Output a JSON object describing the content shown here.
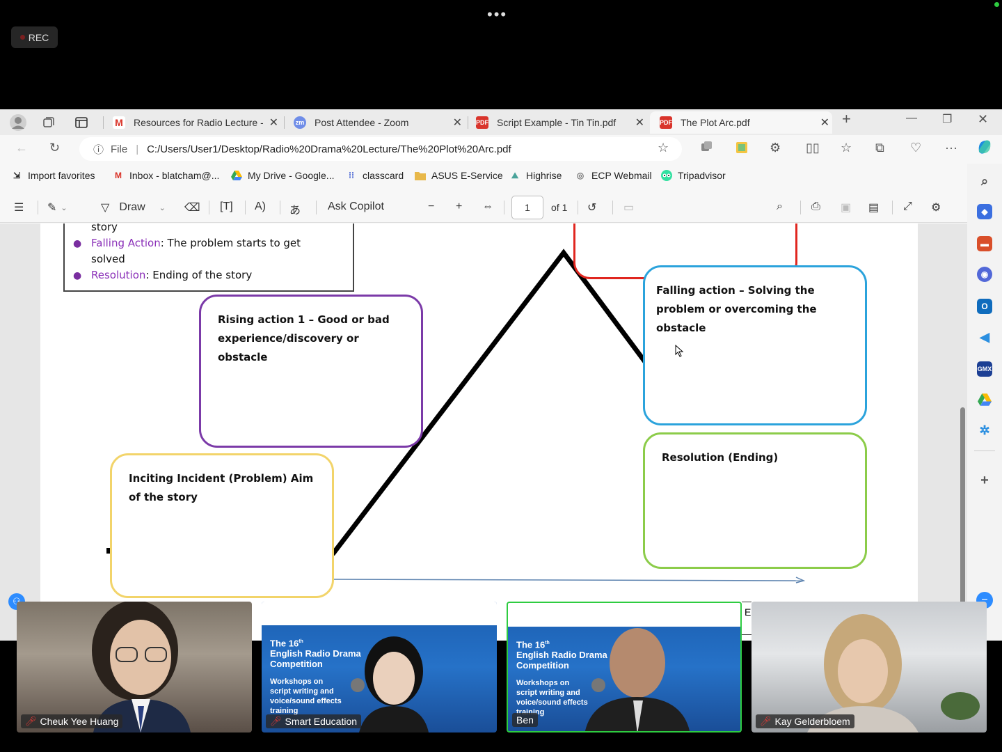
{
  "recording": {
    "label": "REC"
  },
  "browser": {
    "tabs": [
      {
        "label": "Resources for Radio Lecture - b",
        "icon": "gmail-icon"
      },
      {
        "label": "Post Attendee - Zoom",
        "icon": "zoom-icon"
      },
      {
        "label": "Script Example - Tin Tin.pdf",
        "icon": "pdf-icon"
      },
      {
        "label": "The Plot Arc.pdf",
        "icon": "pdf-icon"
      }
    ],
    "address": {
      "scheme_label": "File",
      "url": "C:/Users/User1/Desktop/Radio%20Drama%20Lecture/The%20Plot%20Arc.pdf"
    },
    "favorites": [
      {
        "label": "Import favorites"
      },
      {
        "label": "Inbox - blatcham@..."
      },
      {
        "label": "My Drive - Google..."
      },
      {
        "label": "classcard"
      },
      {
        "label": "ASUS E-Service"
      },
      {
        "label": "Highrise"
      },
      {
        "label": "ECP Webmail"
      },
      {
        "label": "Tripadvisor"
      }
    ]
  },
  "pdf_toolbar": {
    "draw_label": "Draw",
    "ask_copilot_label": "Ask Copilot",
    "page_number": "1",
    "page_total": "of 1"
  },
  "document": {
    "summary": {
      "line0": "story",
      "falling_term": "Falling Action",
      "falling_text": ": The problem starts to get",
      "falling_text2": "solved",
      "resolution_term": "Resolution",
      "resolution_text": ": Ending of the story"
    },
    "boxes": {
      "rising": "Rising action 1 – Good or bad experience/discovery or obstacle",
      "falling": "Falling action – Solving the problem or overcoming the obstacle",
      "resolution": "Resolution (Ending)",
      "inciting": "Inciting Incident (Problem) Aim of the story"
    },
    "colors": {
      "rising": "#7b3aa8",
      "falling": "#2ba3dc",
      "resolution": "#8ccc4a",
      "inciting": "#f2d46a",
      "climax": "#e0261f"
    },
    "clipped_letter": "E"
  },
  "participants": [
    {
      "name": "Cheuk Yee Huang",
      "muted": true
    },
    {
      "name": "Smart Education",
      "muted": true
    },
    {
      "name": "Ben",
      "muted": false,
      "active_speaker": true
    },
    {
      "name": "Kay Gelderbloem",
      "muted": true
    }
  ],
  "poster": {
    "line1": "The 16",
    "sup": "th",
    "line2": "English Radio Drama",
    "line3": "Competition",
    "sub1": "Workshops on",
    "sub2": "script writing and",
    "sub3": "voice/sound effects",
    "sub4": "training"
  }
}
